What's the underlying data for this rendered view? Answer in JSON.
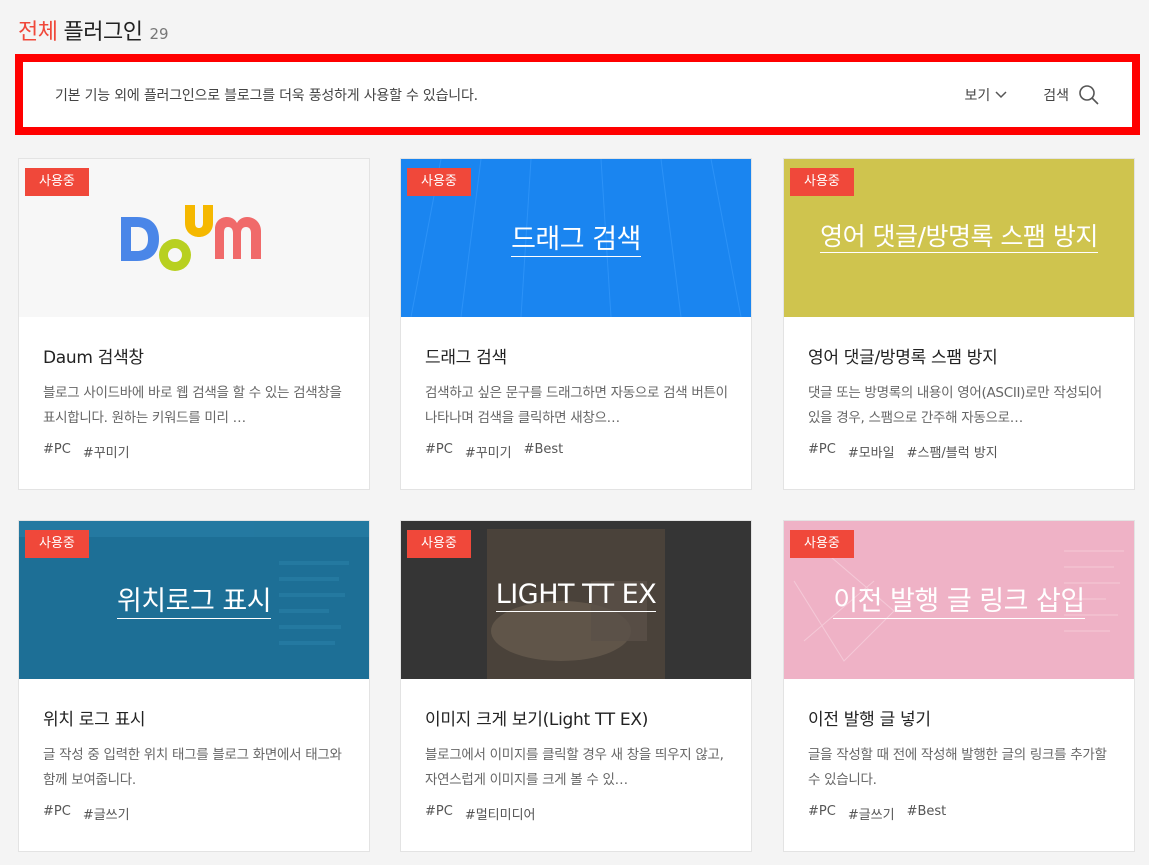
{
  "header": {
    "title_accent": "전체",
    "title_main": "플러그인",
    "count": "29"
  },
  "notice": {
    "text": "기본 기능 외에 플러그인으로 블로그를 더욱 풍성하게 사용할 수 있습니다.",
    "view_label": "보기",
    "search_label": "검색"
  },
  "colors": {
    "accent": "#f0483a",
    "highlight_border": "#ff0000"
  },
  "cards": [
    {
      "badge": "사용중",
      "thumb_title": "",
      "thumb_bg": "#f7f7f7",
      "name": "Daum 검색창",
      "desc": "블로그 사이드바에 바로 웹 검색을 할 수 있는 검색창을 표시합니다. 원하는 키워드를 미리 …",
      "tags": [
        "#PC",
        "#꾸미기"
      ]
    },
    {
      "badge": "사용중",
      "thumb_title": "드래그 검색",
      "thumb_bg": "#1a85f0",
      "name": "드래그 검색",
      "desc": "검색하고 싶은 문구를 드래그하면 자동으로 검색 버튼이 나타나며 검색을 클릭하면 새창으…",
      "tags": [
        "#PC",
        "#꾸미기",
        "#Best"
      ]
    },
    {
      "badge": "사용중",
      "thumb_title": "영어 댓글/방명록 스팸 방지",
      "thumb_bg": "#cfc44e",
      "name": "영어 댓글/방명록 스팸 방지",
      "desc": "댓글 또는 방명록의 내용이 영어(ASCII)로만 작성되어 있을 경우, 스팸으로 간주해 자동으로…",
      "tags": [
        "#PC",
        "#모바일",
        "#스팸/블럭 방지"
      ]
    },
    {
      "badge": "사용중",
      "thumb_title": "위치로그 표시",
      "thumb_bg": "#1d6f96",
      "name": "위치 로그 표시",
      "desc": "글 작성 중 입력한 위치 태그를 블로그 화면에서 태그와 함께 보여줍니다.",
      "tags": [
        "#PC",
        "#글쓰기"
      ]
    },
    {
      "badge": "사용중",
      "thumb_title": "LIGHT TT EX",
      "thumb_bg": "#3a3a3a",
      "name": "이미지 크게 보기(Light TT EX)",
      "desc": "블로그에서 이미지를 클릭할 경우 새 창을 띄우지 않고, 자연스럽게 이미지를 크게 볼 수 있…",
      "tags": [
        "#PC",
        "#멀티미디어"
      ]
    },
    {
      "badge": "사용중",
      "thumb_title": "이전 발행 글 링크 삽입",
      "thumb_bg": "#efb2c6",
      "name": "이전 발행 글 넣기",
      "desc": "글을 작성할 때 전에 작성해 발행한 글의 링크를 추가할 수 있습니다.",
      "tags": [
        "#PC",
        "#글쓰기",
        "#Best"
      ]
    }
  ]
}
